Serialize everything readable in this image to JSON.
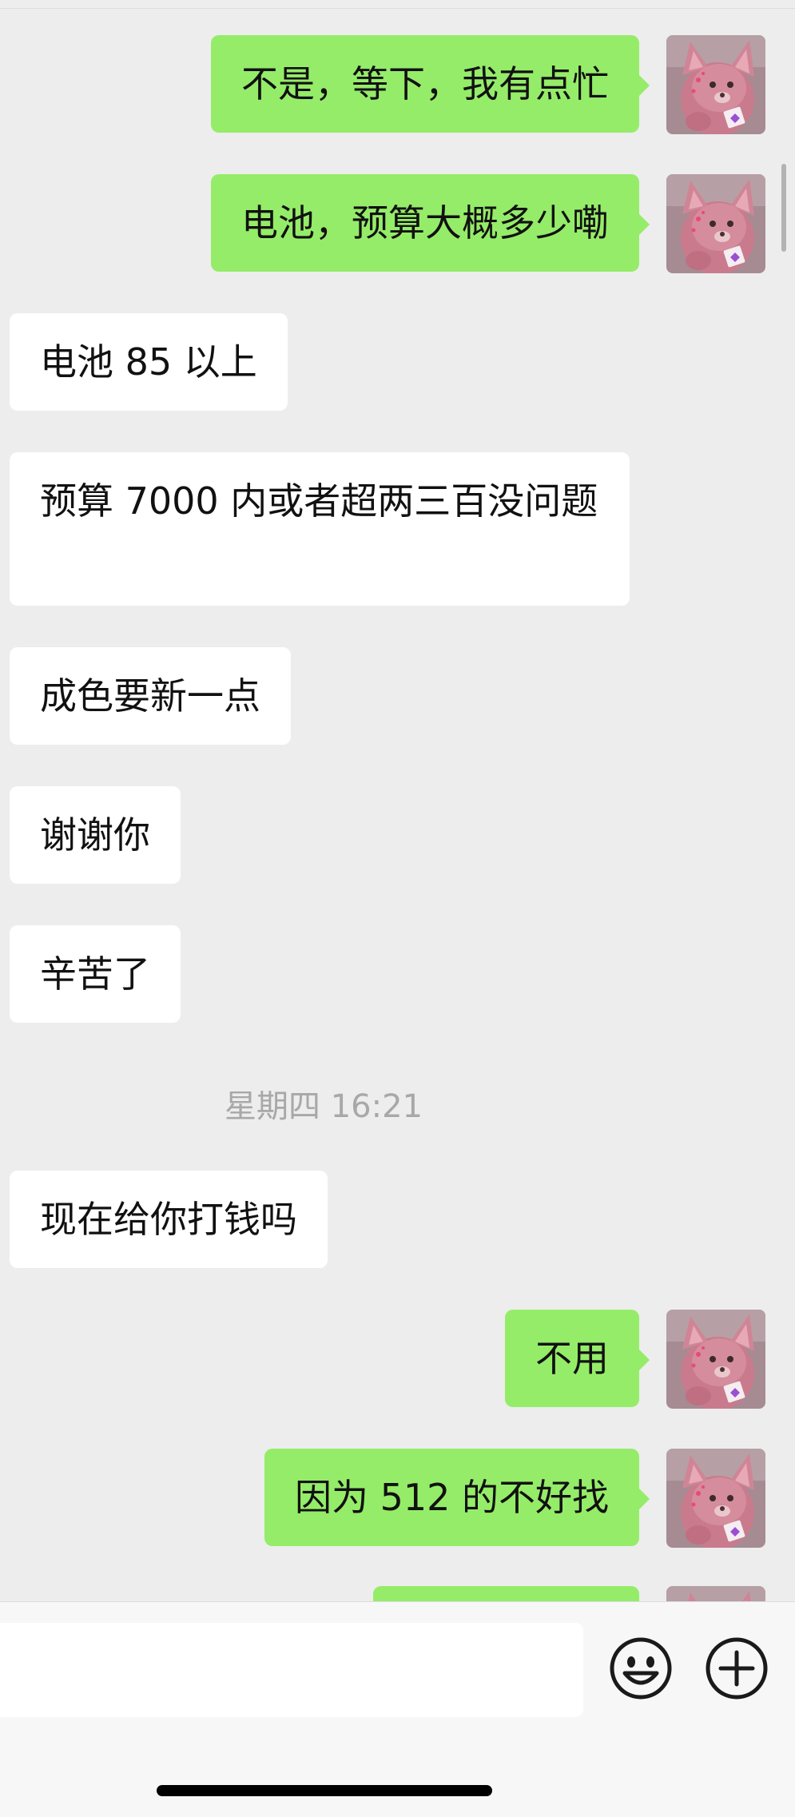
{
  "messages": [
    {
      "sender": "self",
      "text": "不是，等下，我有点忙"
    },
    {
      "sender": "self",
      "text": "电池，预算大概多少嘞"
    },
    {
      "sender": "other",
      "text": "电池 85 以上"
    },
    {
      "sender": "other",
      "text": "预算 7000 内或者超两三百没问题"
    },
    {
      "sender": "other",
      "text": "成色要新一点"
    },
    {
      "sender": "other",
      "text": "谢谢你"
    },
    {
      "sender": "other",
      "text": "辛苦了"
    },
    {
      "sender": "other",
      "text": "现在给你打钱吗"
    },
    {
      "sender": "self",
      "text": "不用"
    },
    {
      "sender": "self",
      "text": "因为 512 的不好找"
    }
  ],
  "timestamp": "星期四 16:21",
  "input": {
    "value": "",
    "placeholder": ""
  },
  "icons": {
    "avatar": "pink-plush-toy-avatar",
    "emoji": "smiley-face-icon",
    "more": "plus-circle-icon"
  },
  "colors": {
    "self_bubble": "#95ec69",
    "other_bubble": "#ffffff",
    "background": "#ededed"
  }
}
